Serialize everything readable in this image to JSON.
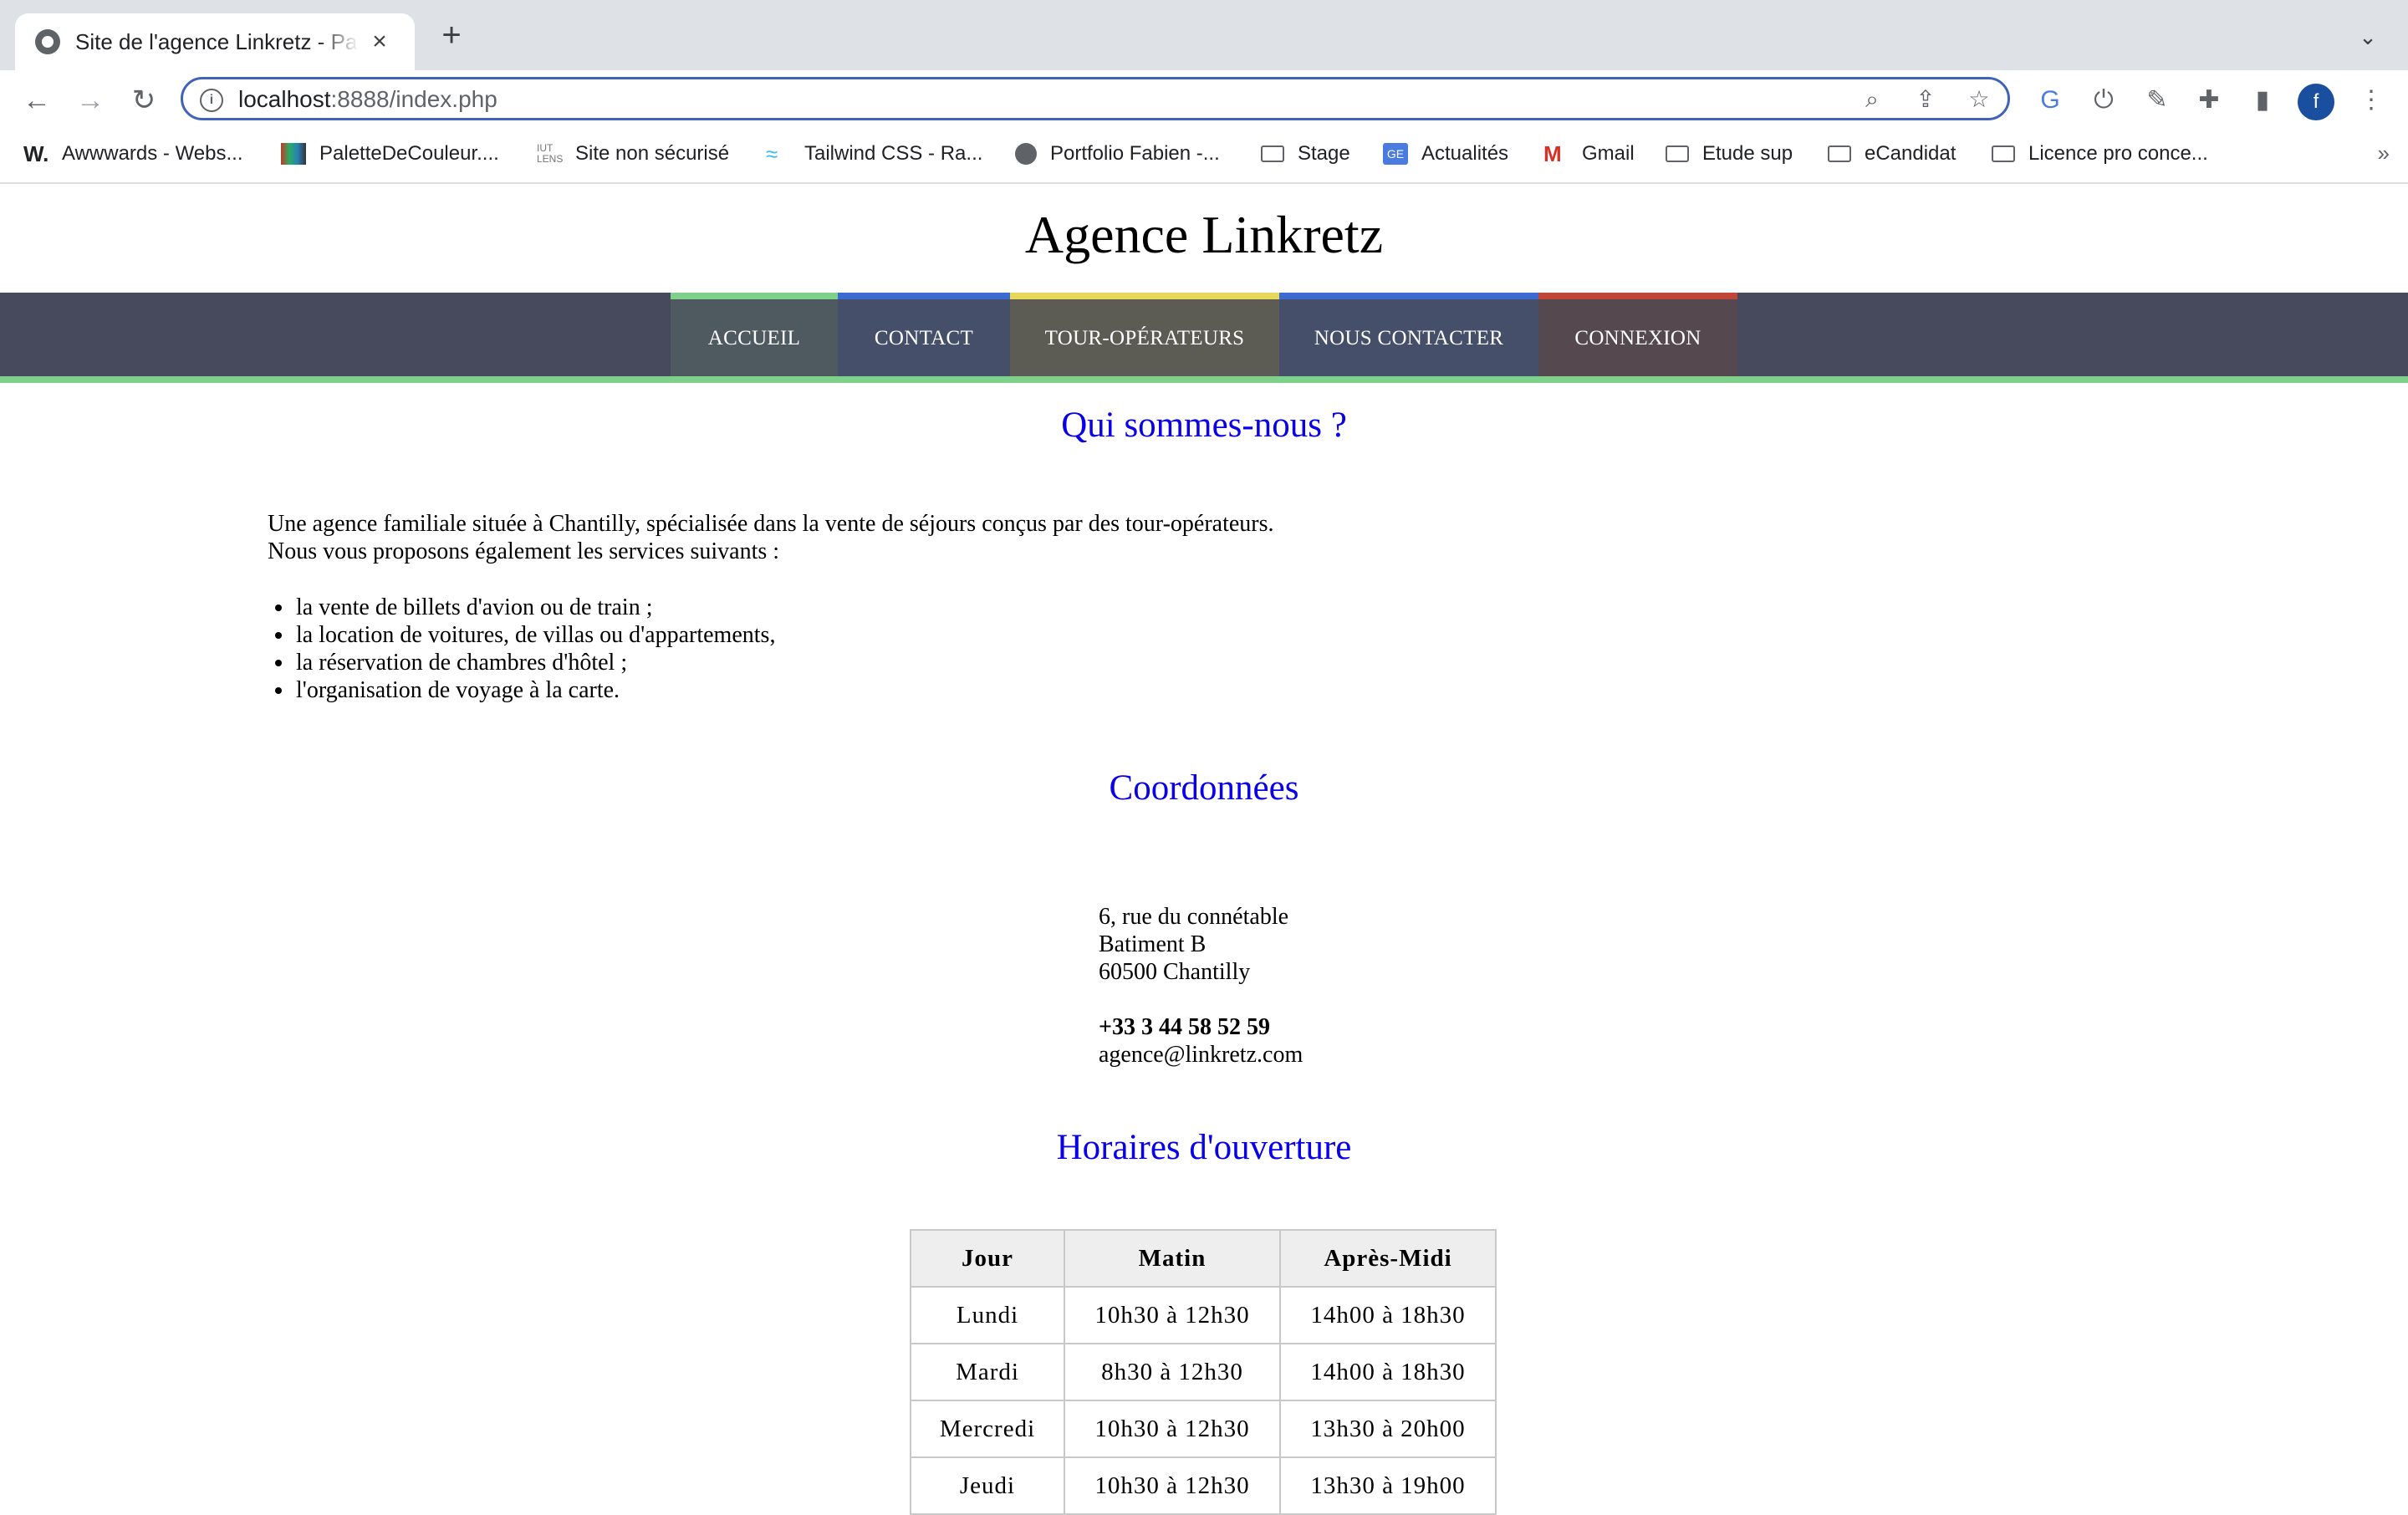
{
  "browser": {
    "tab_title": "Site de l'agence Linkretz - Page d'accueil",
    "url_host": "localhost",
    "url_path": ":8888/index.php",
    "bookmarks": [
      {
        "label": "Awwwards - Webs...",
        "icon": "awwwards-icon"
      },
      {
        "label": "PaletteDeCouleur....",
        "icon": "palette-icon"
      },
      {
        "label": "Site non sécurisé",
        "icon": "iut-icon"
      },
      {
        "label": "Tailwind CSS - Ra...",
        "icon": "tailwind-icon"
      },
      {
        "label": "Portfolio Fabien -...",
        "icon": "globe-icon"
      },
      {
        "label": "Stage",
        "icon": "folder-icon"
      },
      {
        "label": "Actualités",
        "icon": "google-news-icon"
      },
      {
        "label": "Gmail",
        "icon": "gmail-icon"
      },
      {
        "label": "Etude sup",
        "icon": "folder-icon"
      },
      {
        "label": "eCandidat",
        "icon": "folder-icon"
      },
      {
        "label": "Licence pro conce...",
        "icon": "folder-icon"
      }
    ],
    "profile_initial": "f",
    "more_bookmarks": "»"
  },
  "site": {
    "title": "Agence Linkretz",
    "nav": [
      {
        "label": "ACCUEIL",
        "accent": "#7fd08a",
        "bg": "#4f5a60"
      },
      {
        "label": "CONTACT",
        "accent": "#3d6ad0",
        "bg": "#454f6a"
      },
      {
        "label": "TOUR-OPÉRATEURS",
        "accent": "#e6d75a",
        "bg": "#5c5c55"
      },
      {
        "label": "NOUS CONTACTER",
        "accent": "#3d6ad0",
        "bg": "#454f6a"
      },
      {
        "label": "CONNEXION",
        "accent": "#c0463a",
        "bg": "#56484f"
      }
    ]
  },
  "about": {
    "heading": "Qui sommes-nous ?",
    "line1": "Une agence familiale située à Chantilly, spécialisée dans la vente de séjours conçus par des tour-opérateurs.",
    "line2": "Nous vous proposons également les services suivants :",
    "services": [
      "la vente de billets d'avion ou de train ;",
      "la location de voitures, de villas ou d'appartements,",
      "la réservation de chambres d'hôtel ;",
      "l'organisation de voyage à la carte."
    ]
  },
  "contact": {
    "heading": "Coordonnées",
    "street": "6, rue du connétable",
    "building": "Batiment B",
    "city": "60500 Chantilly",
    "phone": "+33 3 44 58 52 59",
    "email": "agence@linkretz.com"
  },
  "hours": {
    "heading": "Horaires d'ouverture",
    "columns": [
      "Jour",
      "Matin",
      "Après-Midi"
    ],
    "rows": [
      [
        "Lundi",
        "10h30 à 12h30",
        "14h00 à 18h30"
      ],
      [
        "Mardi",
        "8h30 à 12h30",
        "14h00 à 18h30"
      ],
      [
        "Mercredi",
        "10h30 à 12h30",
        "13h30 à 20h00"
      ],
      [
        "Jeudi",
        "10h30 à 12h30",
        "13h30 à 19h00"
      ]
    ]
  }
}
